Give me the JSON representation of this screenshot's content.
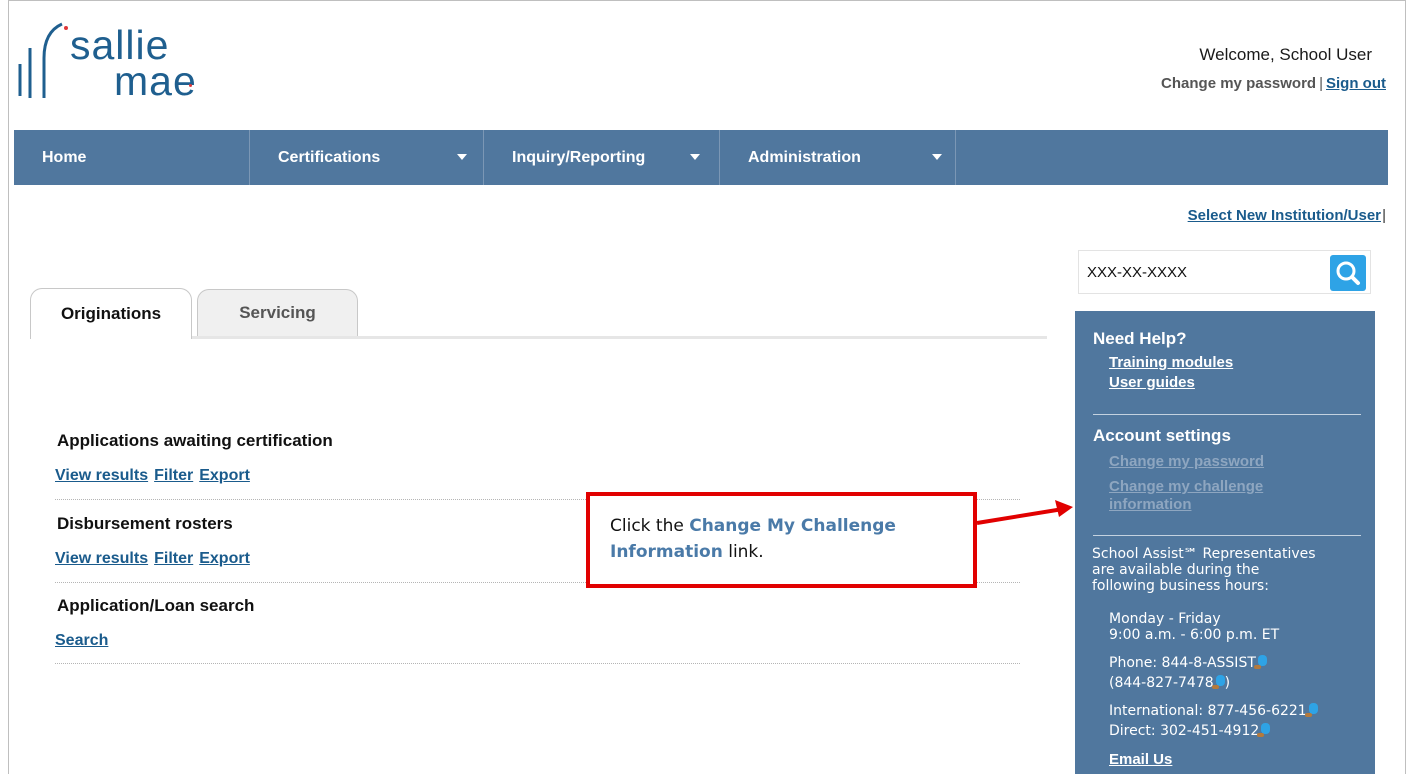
{
  "brand": {
    "name_line1": "sallie",
    "name_line2": "mae",
    "colors": {
      "primary": "#1f5f8f",
      "nav": "#50779e",
      "link": "#1a5b8c",
      "accent_dot": "#e0383b",
      "search_button": "#2ea3e6",
      "callout_border": "#e10000"
    }
  },
  "header": {
    "welcome": "Welcome, School User",
    "change_password": "Change my password",
    "separator": "|",
    "sign_out": "Sign out"
  },
  "nav": {
    "items": [
      {
        "label": "Home",
        "dropdown": false
      },
      {
        "label": "Certifications",
        "dropdown": true
      },
      {
        "label": "Inquiry/Reporting",
        "dropdown": true
      },
      {
        "label": "Administration",
        "dropdown": true
      }
    ]
  },
  "toolbar": {
    "select_institution": "Select New Institution/User",
    "pipe": "|"
  },
  "search": {
    "value": "XXX-XX-XXXX",
    "icon": "search-icon"
  },
  "tabs": [
    {
      "label": "Originations",
      "active": true
    },
    {
      "label": "Servicing",
      "active": false
    }
  ],
  "sections": [
    {
      "title": "Applications awaiting certification",
      "links": [
        "View results",
        "Filter",
        "Export"
      ]
    },
    {
      "title": "Disbursement rosters",
      "links": [
        "View results",
        "Filter",
        "Export"
      ]
    },
    {
      "title": "Application/Loan search",
      "links": [
        "Search"
      ]
    }
  ],
  "callout": {
    "prefix": "Click the ",
    "highlight": "Change My Challenge Information",
    "suffix": " link."
  },
  "help_panel": {
    "need_help": "Need Help?",
    "training_modules": "Training modules",
    "user_guides": "User guides",
    "account_settings": "Account settings",
    "change_password": "Change my password",
    "change_challenge_line1": "Change my challenge",
    "change_challenge_line2": "information",
    "reps_line1": "School Assist℠ Representatives",
    "reps_line2": "are available during the",
    "reps_line3": "following business hours:",
    "days": "Monday - Friday",
    "hours": "9:00 a.m. - 6:00 p.m. ET",
    "phone": "Phone: 844-8-ASSIST",
    "phone_numeric": "(844-827-7478",
    "phone_numeric_close": ")",
    "international": "International: 877-456-6221",
    "direct": "Direct: 302-451-4912",
    "email": "Email Us"
  }
}
